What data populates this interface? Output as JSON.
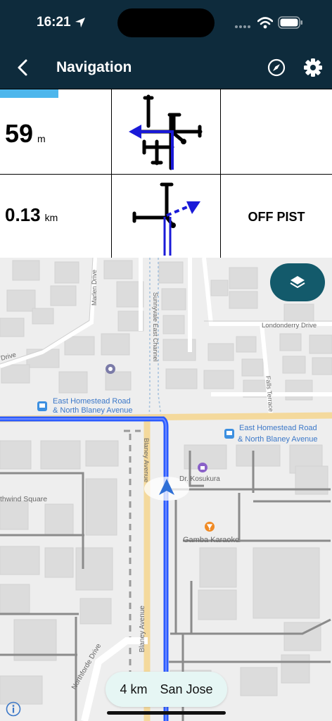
{
  "status_bar": {
    "time": "16:21"
  },
  "header": {
    "title": "Navigation"
  },
  "panel": {
    "row1": {
      "distance": "59",
      "unit": "m",
      "progress": 0.18
    },
    "row2": {
      "distance": "0.13",
      "unit": "km",
      "label": "OFF PIST"
    }
  },
  "map": {
    "labels": {
      "marlen": "Marlen Drive",
      "channel": "Sunnyvale East Channel",
      "londonderry": "Londonderry Drive",
      "drive_left": "Drive",
      "falls": "Falls Terrace",
      "ehr_left_1": "East Homestead Road",
      "ehr_left_2": "& North Blaney Avenue",
      "ehr_right_1": "East Homestead Road",
      "ehr_right_2": "& North Blaney Avenue",
      "blaney_top": "Blaney Avenue",
      "kosukura": "Dr. Kosukura",
      "windsquare": "thwind Square",
      "gamba": "Gamba Karaoke",
      "northforde": "Northforde Drive",
      "blaney_bottom": "Blaney Avenue"
    }
  },
  "route": {
    "distance": "4 km",
    "destination": "San Jose"
  },
  "icons": [
    "location-arrow-icon",
    "wifi-icon",
    "battery-icon",
    "back-chevron-icon",
    "compass-icon",
    "gear-icon",
    "layers-icon",
    "info-icon",
    "bus-stop-icon",
    "shopping-bag-icon",
    "karaoke-icon",
    "wheelchair-icon",
    "navigation-arrow-icon"
  ],
  "colors": {
    "header": "#0e2b3c",
    "progress": "#4db6ec",
    "route": "#2a5bff",
    "layers_button": "#135a6b",
    "pill": "#e6f6f4"
  }
}
